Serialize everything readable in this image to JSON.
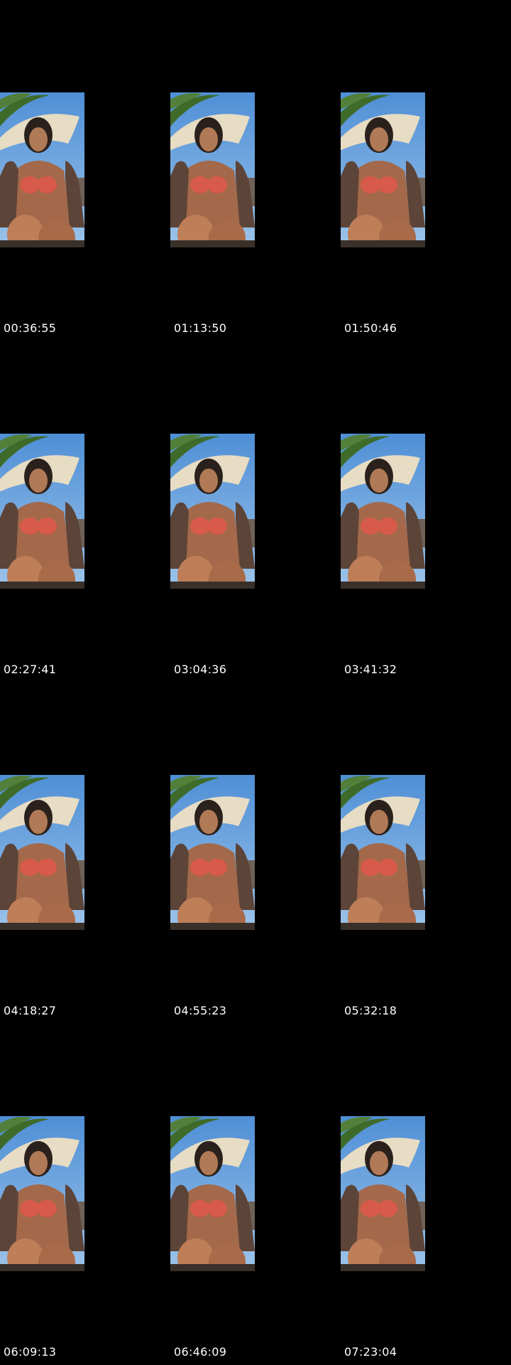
{
  "sheet": {
    "background_color": "#000000",
    "timestamp_color": "#ffffff",
    "frames": [
      {
        "timestamp": "00:36:55",
        "thumbnail": "video-frame-image"
      },
      {
        "timestamp": "01:13:50",
        "thumbnail": "video-frame-image"
      },
      {
        "timestamp": "01:50:46",
        "thumbnail": "video-frame-image"
      },
      {
        "timestamp": "02:27:41",
        "thumbnail": "video-frame-image"
      },
      {
        "timestamp": "03:04:36",
        "thumbnail": "video-frame-image"
      },
      {
        "timestamp": "03:41:32",
        "thumbnail": "video-frame-image"
      },
      {
        "timestamp": "04:18:27",
        "thumbnail": "video-frame-image"
      },
      {
        "timestamp": "04:55:23",
        "thumbnail": "video-frame-image"
      },
      {
        "timestamp": "05:32:18",
        "thumbnail": "video-frame-image"
      },
      {
        "timestamp": "06:09:13",
        "thumbnail": "video-frame-image"
      },
      {
        "timestamp": "06:46:09",
        "thumbnail": "video-frame-image"
      },
      {
        "timestamp": "07:23:04",
        "thumbnail": "video-frame-image"
      }
    ]
  }
}
